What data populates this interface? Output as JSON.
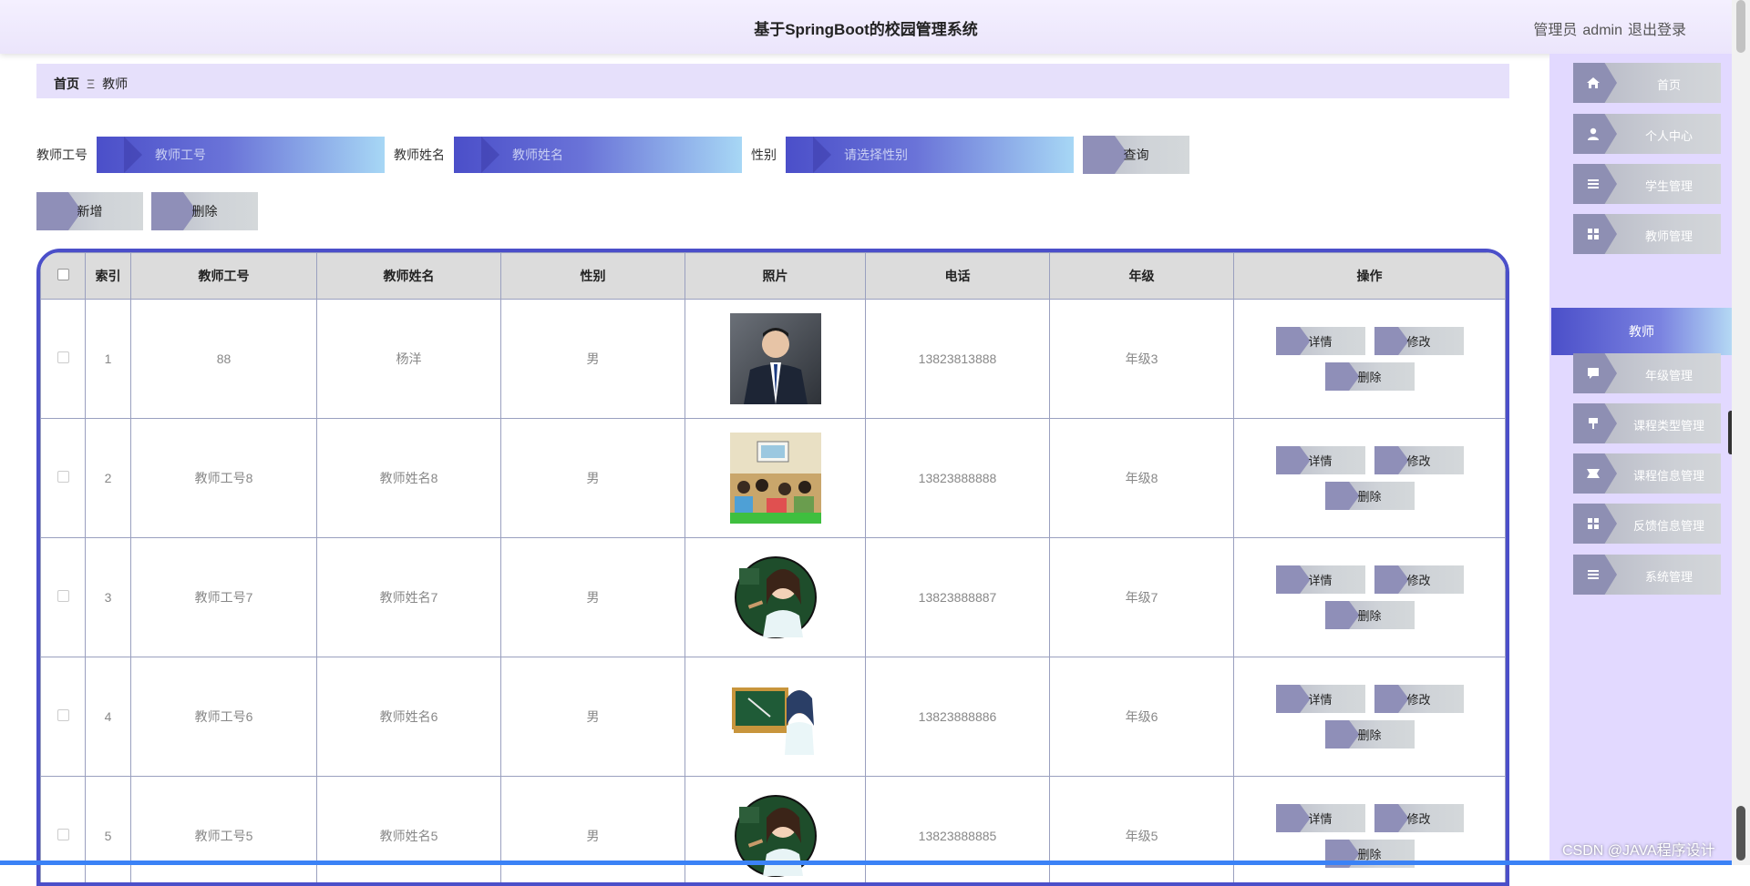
{
  "header": {
    "title": "基于SpringBoot的校园管理系统",
    "role_label": "管理员",
    "username": "admin",
    "logout_label": "退出登录"
  },
  "breadcrumb": {
    "home": "首页",
    "separator": "Ξ",
    "current": "教师"
  },
  "search": {
    "fields": [
      {
        "label": "教师工号",
        "placeholder": "教师工号"
      },
      {
        "label": "教师姓名",
        "placeholder": "教师姓名"
      },
      {
        "label": "性别",
        "placeholder": "请选择性别"
      }
    ],
    "query_label": "查询"
  },
  "toolbar": {
    "add_label": "新增",
    "delete_label": "删除"
  },
  "table": {
    "headers": [
      "索引",
      "教师工号",
      "教师姓名",
      "性别",
      "照片",
      "电话",
      "年级",
      "操作"
    ],
    "rows": [
      {
        "index": "1",
        "teacher_no": "88",
        "name": "杨洋",
        "gender": "男",
        "photo": "man-suit",
        "phone": "13823813888",
        "grade": "年级3"
      },
      {
        "index": "2",
        "teacher_no": "教师工号8",
        "name": "教师姓名8",
        "gender": "男",
        "photo": "classroom",
        "phone": "13823888888",
        "grade": "年级8"
      },
      {
        "index": "3",
        "teacher_no": "教师工号7",
        "name": "教师姓名7",
        "gender": "男",
        "photo": "teacher-cartoon-round",
        "phone": "13823888887",
        "grade": "年级7"
      },
      {
        "index": "4",
        "teacher_no": "教师工号6",
        "name": "教师姓名6",
        "gender": "男",
        "photo": "teacher-cartoon-board",
        "phone": "13823888886",
        "grade": "年级6"
      },
      {
        "index": "5",
        "teacher_no": "教师工号5",
        "name": "教师姓名5",
        "gender": "男",
        "photo": "teacher-cartoon-round",
        "phone": "13823888885",
        "grade": "年级5"
      }
    ],
    "actions": {
      "detail": "详情",
      "edit": "修改",
      "delete": "删除"
    }
  },
  "sidebar": {
    "items": [
      {
        "label": "首页",
        "icon": "home-icon"
      },
      {
        "label": "个人中心",
        "icon": "user-icon"
      },
      {
        "label": "学生管理",
        "icon": "list-icon"
      },
      {
        "label": "教师管理",
        "icon": "grid-icon"
      },
      {
        "label": "教师",
        "active": true
      },
      {
        "label": "年级管理",
        "icon": "chat-icon"
      },
      {
        "label": "课程类型管理",
        "icon": "pin-icon"
      },
      {
        "label": "课程信息管理",
        "icon": "ticket-icon"
      },
      {
        "label": "反馈信息管理",
        "icon": "grid-icon"
      },
      {
        "label": "系统管理",
        "icon": "list-icon"
      }
    ]
  },
  "watermark": "CSDN @JAVA程序设计",
  "colors": {
    "accent": "#4b4fc9",
    "sidebar_bg": "#e2d9ff",
    "header_bg": "#efe9fd",
    "button_gray": "#cfd3d8"
  }
}
